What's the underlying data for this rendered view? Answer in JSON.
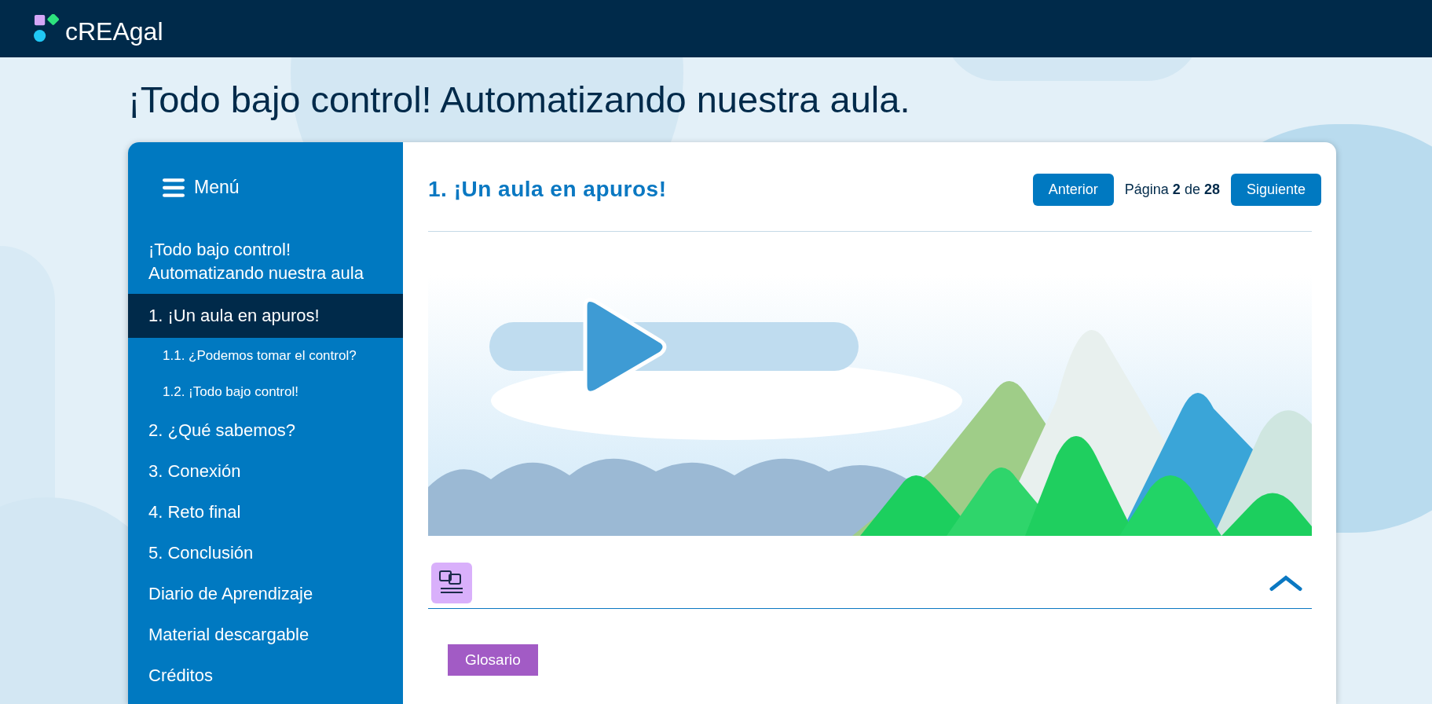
{
  "logo": {
    "text": "cREAgal"
  },
  "page_title": "¡Todo bajo control! Automatizando nuestra aula.",
  "menu": {
    "label": "Menú",
    "items": [
      {
        "label": "¡Todo bajo control! Automatizando nuestra aula",
        "selected": false
      },
      {
        "label": "1. ¡Un aula en apuros!",
        "selected": true,
        "children": [
          {
            "label": "1.1. ¿Podemos tomar el control?",
            "selected": false
          },
          {
            "label": "1.2. ¡Todo bajo control!",
            "selected": false
          }
        ]
      },
      {
        "label": "2. ¿Qué sabemos?",
        "selected": false
      },
      {
        "label": "3. Conexión",
        "selected": false
      },
      {
        "label": "4. Reto final",
        "selected": false
      },
      {
        "label": "5. Conclusión",
        "selected": false
      },
      {
        "label": "Diario de Aprendizaje",
        "selected": false
      },
      {
        "label": "Material descargable",
        "selected": false
      },
      {
        "label": "Créditos",
        "selected": false
      }
    ]
  },
  "section": {
    "title": "1. ¡Un aula en apuros!",
    "prev": "Anterior",
    "page_info": "Página **2** de **28**",
    "next": "Siguiente"
  },
  "glossary": {
    "expanded": true,
    "button": "Glosario"
  }
}
